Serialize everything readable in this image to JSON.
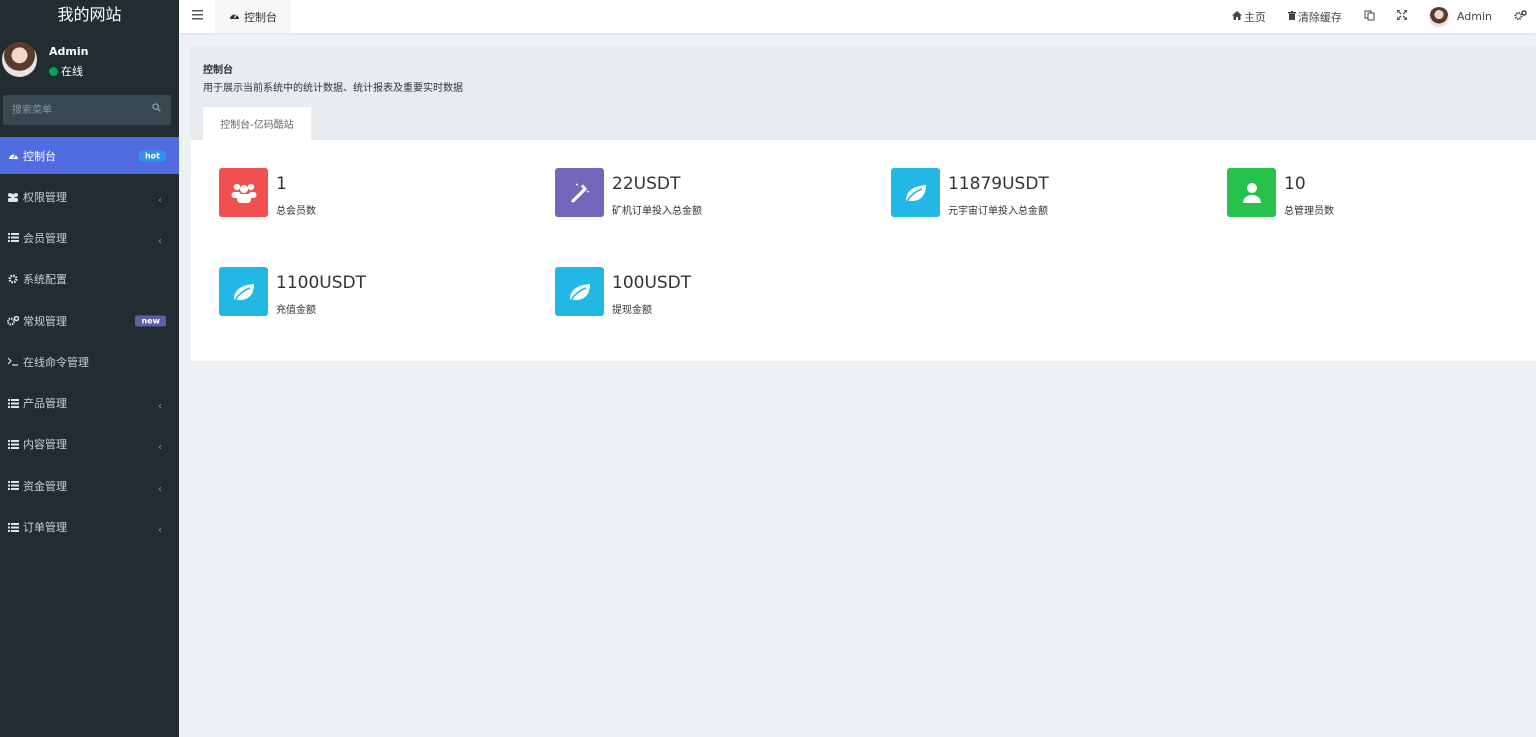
{
  "sidebar": {
    "brand": "我的网站",
    "user": {
      "name": "Admin",
      "status": "在线"
    },
    "search_placeholder": "搜索菜单",
    "items": [
      {
        "label": "控制台",
        "icon": "dashboard-icon",
        "badge": "hot",
        "active": true
      },
      {
        "label": "权限管理",
        "icon": "users-icon",
        "chevron": true
      },
      {
        "label": "会员管理",
        "icon": "list-icon",
        "chevron": true
      },
      {
        "label": "系统配置",
        "icon": "gear-icon"
      },
      {
        "label": "常规管理",
        "icon": "cogs-icon",
        "badge": "new"
      },
      {
        "label": "在线命令管理",
        "icon": "terminal-icon"
      },
      {
        "label": "产品管理",
        "icon": "list-icon",
        "chevron": true
      },
      {
        "label": "内容管理",
        "icon": "list-icon",
        "chevron": true
      },
      {
        "label": "资金管理",
        "icon": "list-icon",
        "chevron": true
      },
      {
        "label": "订单管理",
        "icon": "list-icon",
        "chevron": true
      }
    ]
  },
  "topbar": {
    "tab": "控制台",
    "home": "主页",
    "clear_cache": "清除缓存",
    "user": "Admin"
  },
  "header": {
    "title": "控制台",
    "description": "用于展示当前系统中的统计数据、统计报表及重要实时数据",
    "tab": "控制台-亿码酷站"
  },
  "stats": [
    {
      "value": "1",
      "label": "总会员数",
      "color": "#f05050",
      "icon": "users-icon"
    },
    {
      "value": "22USDT",
      "label": "矿机订单投入总金额",
      "color": "#7266ba",
      "icon": "magic-wand-icon"
    },
    {
      "value": "11879USDT",
      "label": "元宇宙订单投入总金额",
      "color": "#23b7e5",
      "icon": "leaf-icon"
    },
    {
      "value": "10",
      "label": "总管理员数",
      "color": "#27c24c",
      "icon": "user-icon"
    },
    {
      "value": "1100USDT",
      "label": "充值金额",
      "color": "#23b7e5",
      "icon": "leaf-icon"
    },
    {
      "value": "100USDT",
      "label": "提现金额",
      "color": "#23b7e5",
      "icon": "leaf-icon"
    }
  ]
}
